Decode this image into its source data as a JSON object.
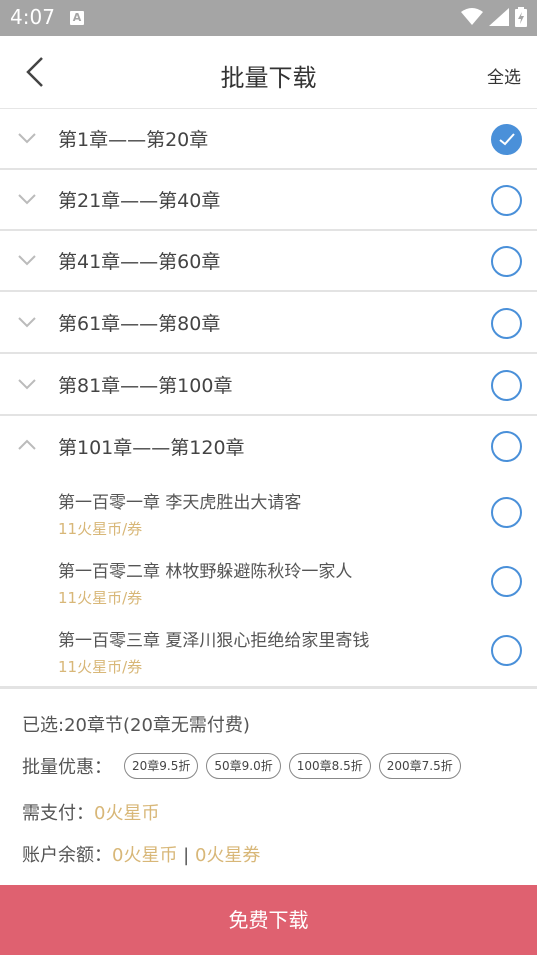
{
  "status_bar": {
    "time": "4:07",
    "notification_letter": "A"
  },
  "header": {
    "title": "批量下载",
    "select_all": "全选"
  },
  "ranges": [
    {
      "label": "第1章——第20章",
      "checked": true
    },
    {
      "label": "第21章——第40章",
      "checked": false
    },
    {
      "label": "第41章——第60章",
      "checked": false
    },
    {
      "label": "第61章——第80章",
      "checked": false
    },
    {
      "label": "第81章——第100章",
      "checked": false
    }
  ],
  "expanded": {
    "label": "第101章——第120章",
    "chapters": [
      {
        "title": "第一百零一章 李天虎胜出大请客",
        "price": "11火星币/券"
      },
      {
        "title": "第一百零二章 林牧野躲避陈秋玲一家人",
        "price": "11火星币/券"
      },
      {
        "title": "第一百零三章 夏泽川狠心拒绝给家里寄钱",
        "price": "11火星币/券"
      }
    ]
  },
  "summary": {
    "selected": "已选:20章节(20章无需付费)",
    "discount_label": "批量优惠：",
    "discounts": [
      "20章9.5折",
      "50章9.0折",
      "100章8.5折",
      "200章7.5折"
    ],
    "pay_label": "需支付：",
    "pay_value": "0火星币",
    "balance_label": "账户余额：",
    "balance_coins": "0火星币",
    "balance_sep": " | ",
    "balance_vouchers": "0火星券"
  },
  "download_button": "免费下载",
  "colors": {
    "accent": "#4a90d9",
    "gold": "#d8b778",
    "button": "#df6170"
  }
}
